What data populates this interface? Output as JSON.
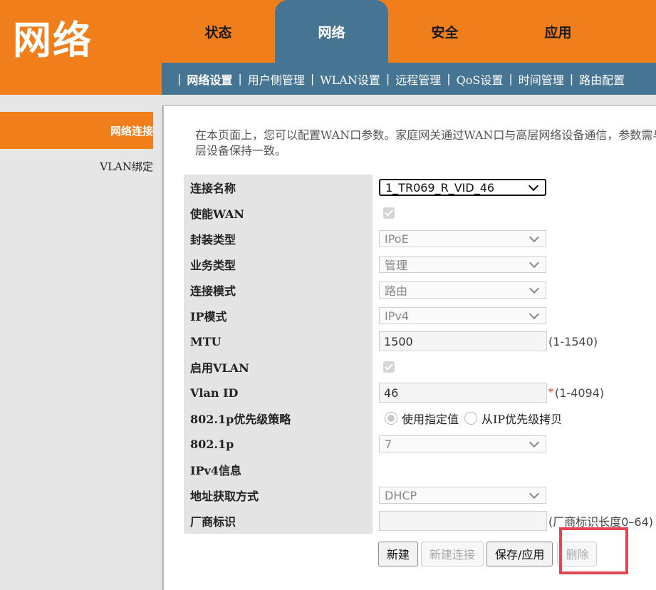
{
  "logo": {
    "text": "网络"
  },
  "top_tabs": [
    {
      "label": "状态",
      "active": false
    },
    {
      "label": "网络",
      "active": true
    },
    {
      "label": "安全",
      "active": false
    },
    {
      "label": "应用",
      "active": false
    }
  ],
  "subnav": [
    {
      "label": "网络设置",
      "active": true
    },
    {
      "label": "用户侧管理"
    },
    {
      "label": "WLAN设置"
    },
    {
      "label": "远程管理"
    },
    {
      "label": "QoS设置"
    },
    {
      "label": "时间管理"
    },
    {
      "label": "路由配置"
    }
  ],
  "sidebar": [
    {
      "label": "网络连接",
      "active": true
    },
    {
      "label": "VLAN绑定",
      "active": false
    }
  ],
  "intro": "在本页面上，您可以配置WAN口参数。家庭网关通过WAN口与高层网络设备通信，参数需与上层设备保持一致。",
  "form": {
    "connection_name": {
      "label": "连接名称",
      "value": "1_TR069_R_VID_46"
    },
    "enable_wan": {
      "label": "使能WAN",
      "checked": true
    },
    "encap_type": {
      "label": "封装类型",
      "value": "IPoE"
    },
    "service_type": {
      "label": "业务类型",
      "value": "管理"
    },
    "conn_mode": {
      "label": "连接模式",
      "value": "路由"
    },
    "ip_mode": {
      "label": "IP模式",
      "value": "IPv4"
    },
    "mtu": {
      "label": "MTU",
      "value": "1500",
      "hint": "(1-1540)"
    },
    "enable_vlan": {
      "label": "启用VLAN",
      "checked": true
    },
    "vlan_id": {
      "label": "Vlan ID",
      "value": "46",
      "required": "*",
      "hint": "(1-4094)"
    },
    "priority_policy": {
      "label": "802.1p优先级策略",
      "option1": "使用指定值",
      "option2": "从IP优先级拷贝"
    },
    "p8021": {
      "label": "802.1p",
      "value": "7"
    },
    "ipv4_info": {
      "label": "IPv4信息"
    },
    "addr_method": {
      "label": "地址获取方式",
      "value": "DHCP"
    },
    "vendor_id": {
      "label": "厂商标识",
      "value": "",
      "hint": "(厂商标识长度0–64)"
    }
  },
  "buttons": {
    "new": "新建",
    "new_conn": "新建连接",
    "save": "保存/应用",
    "delete": "删除"
  },
  "colors": {
    "orange": "#f07e1b",
    "blue": "#467593",
    "highlight": "#e34651"
  }
}
